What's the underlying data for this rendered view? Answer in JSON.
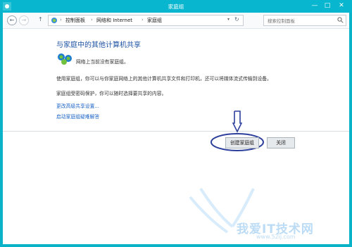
{
  "window": {
    "title": "家庭组",
    "controls": {
      "minimize": "—",
      "maximize": "□",
      "close": "✕"
    }
  },
  "nav": {
    "back": "←",
    "forward": "→",
    "up": "↑",
    "breadcrumb": [
      "控制面板",
      "网络和 Internet",
      "家庭组"
    ],
    "search_placeholder": "搜索控制面板"
  },
  "main": {
    "heading": "与家庭中的其他计算机共享",
    "status": "网络上当前没有家庭组。",
    "description": "使用家庭组，你可以与你家庭网络上的其他计算机共享文件和打印机，还可以将媒体流式传输到设备。",
    "password_note": "家庭组受密码保护，你可以随时选择要共享的内容。",
    "links": {
      "advanced_sharing": "更改高级共享设置...",
      "troubleshooter": "启动家庭组疑难解答"
    }
  },
  "buttons": {
    "create": "创建家庭组",
    "close": "关闭"
  },
  "watermark": {
    "text": "我爱IT技术网",
    "url": "www.52ij.com"
  },
  "colors": {
    "titlebar": "#08b7cf",
    "heading": "#1e53a3",
    "link": "#1b63c6",
    "annotation": "#2c3f9c"
  }
}
